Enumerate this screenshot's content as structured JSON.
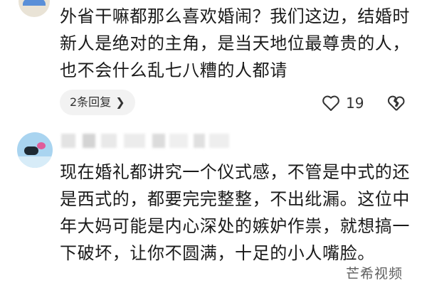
{
  "comments": [
    {
      "text": "外省干嘛都那么喜欢婚闹？我们这边，结婚时新人是绝对的主角，是当天地位最尊贵的人，也不会什么乱七八糟的人都请",
      "replies_label": "2条回复",
      "like_count": "19"
    },
    {
      "text": "现在婚礼都讲究一个仪式感，不管是中式的还是西式的，都要完完整整，不出纰漏。这位中年大妈可能是内心深处的嫉妒作祟，就想搞一下破坏，让你不圆满，十足的小人嘴脸。"
    }
  ],
  "watermark": "芒希视频"
}
